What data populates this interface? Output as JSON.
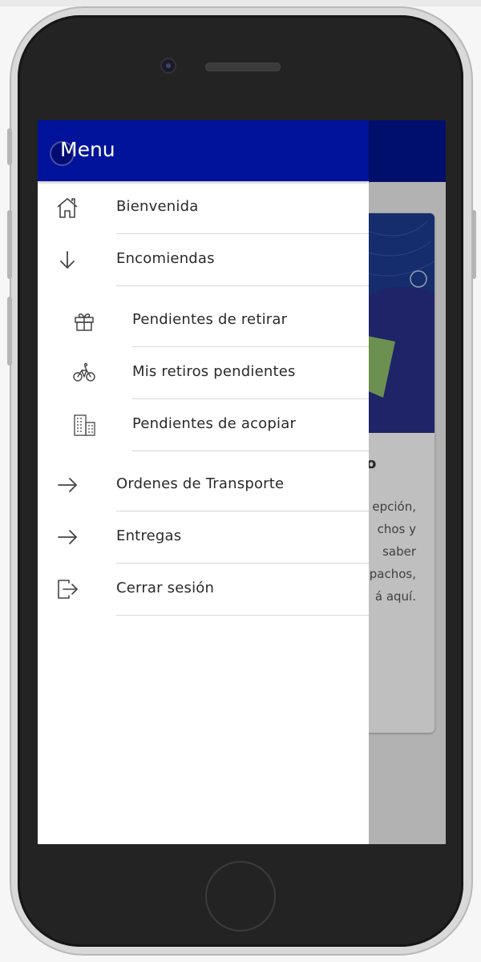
{
  "menu": {
    "title": "Menu",
    "items": [
      {
        "label": "Bienvenida",
        "icon": "home-icon"
      },
      {
        "label": "Encomiendas",
        "icon": "arrow-down-icon"
      },
      {
        "label": "Pendientes de retirar",
        "icon": "gift-icon"
      },
      {
        "label": "Mis retiros pendientes",
        "icon": "bicycle-icon"
      },
      {
        "label": "Pendientes de acopiar",
        "icon": "building-icon"
      },
      {
        "label": "Ordenes de Transporte",
        "icon": "arrow-right-icon"
      },
      {
        "label": "Entregas",
        "icon": "arrow-right-icon"
      },
      {
        "label": "Cerrar sesión",
        "icon": "logout-icon"
      }
    ]
  },
  "background_card": {
    "title_fragment": "o",
    "text_lines": [
      "epción,",
      "chos y",
      "saber",
      "pachos,",
      "á aquí."
    ]
  },
  "colors": {
    "header_blue": "#00139a",
    "text": "#2a2a2a",
    "divider": "#d9d9d9"
  }
}
